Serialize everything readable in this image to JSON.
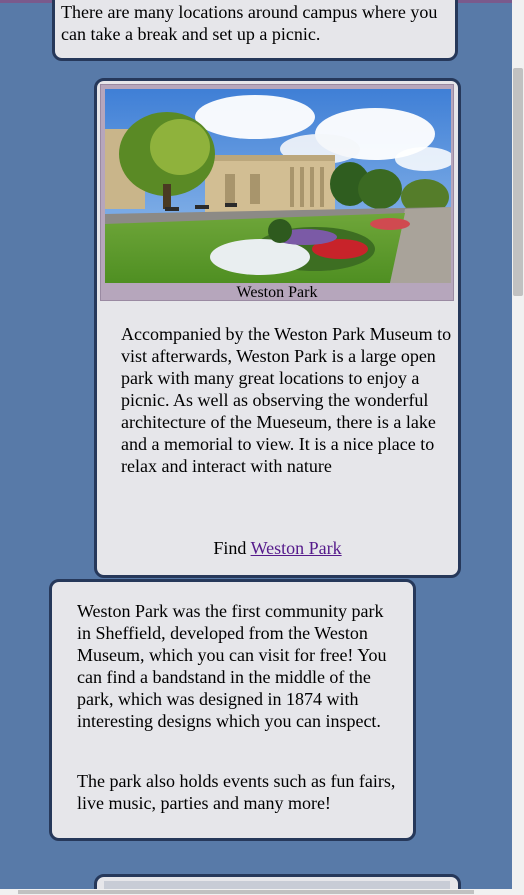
{
  "intro": {
    "text": "There are many locations around campus where you can take a break and set up a picnic."
  },
  "weston_card": {
    "image_alt": "Weston Park",
    "caption": "Weston Park",
    "description": "Accompanied by the Weston Park Museum to vist afterwards, Weston Park is a large open park with many great locations to enjoy a picnic. As well as observing the wonderful architecture of the Mueseum, there is a lake and a memorial to view. It is a nice place to relax and interact with nature",
    "find_prefix": "Find",
    "find_link": "Weston Park"
  },
  "history_card": {
    "paragraph1": "Weston Park was the first community park in Sheffield, developed from the Weston Museum, which you can visit for free! You can find a bandstand in the middle of the park, which was designed in 1874 with interesting designs which you can inspect.",
    "paragraph2": "The park also holds events such as fun fairs, live music, parties and many more!"
  },
  "colors": {
    "page_background": "#587aa8",
    "card_background": "#e6e6ea",
    "card_border": "#26385a",
    "link": "#551a8b"
  }
}
